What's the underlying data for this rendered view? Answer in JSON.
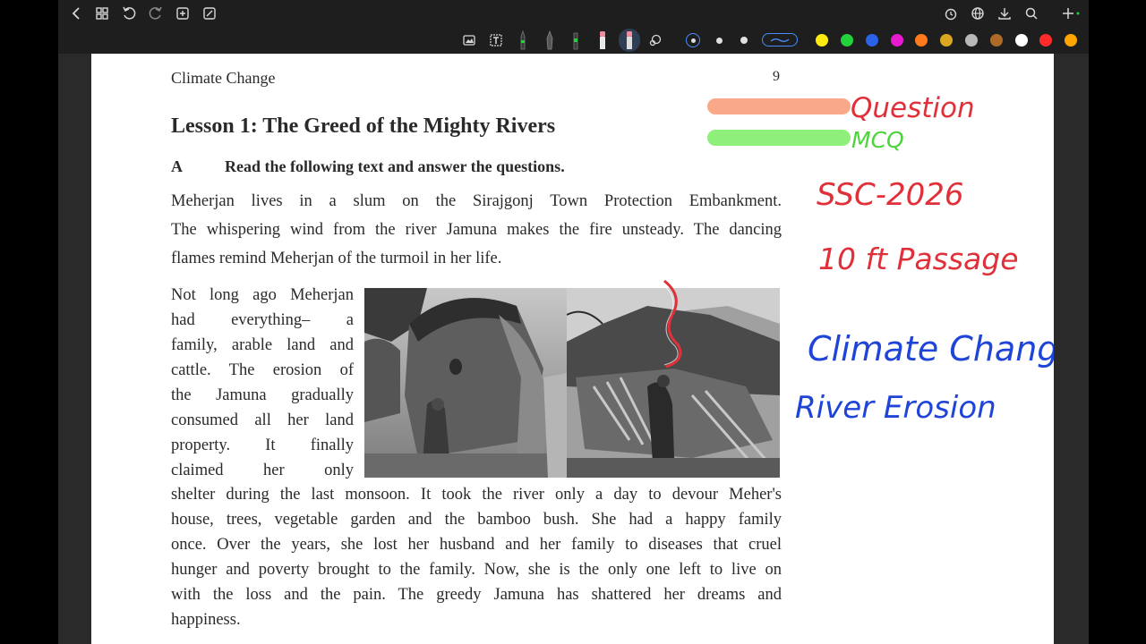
{
  "toolbar": {
    "icons": [
      "back-icon",
      "grid-icon",
      "undo-icon",
      "redo-icon",
      "add-page-icon",
      "edit-icon",
      "alarm-icon",
      "globe-icon",
      "download-icon",
      "search-icon",
      "add-icon"
    ],
    "tools": [
      "image-tool-icon",
      "text-tool-icon",
      "pen-tool-icon",
      "fountain-pen-icon",
      "highlighter-icon",
      "eraser-icon",
      "active-pencil-icon",
      "lasso-icon"
    ],
    "colors": [
      "#ffeb10",
      "#22d13c",
      "#2a62e8",
      "#e81bd0",
      "#ff7a1a",
      "#d9a820",
      "#b8b8b8",
      "#b06a28",
      "#ffffff",
      "#ff2a2a",
      "#ffa500"
    ]
  },
  "page": {
    "running_head": "Climate Change",
    "page_number": "9",
    "lesson_title": "Lesson 1: The Greed of the Mighty Rivers",
    "section_letter": "A",
    "instruction": "Read the following text and answer the questions.",
    "intro_lines": [
      "Meherjan lives in a slum on the Sirajgonj Town Protection Embankment.",
      "The whispering wind from the river Jamuna makes the fire unsteady. The dancing",
      "flames remind Meherjan of the turmoil in her life."
    ],
    "wrapped_lines": [
      "Not long ago Meherjan",
      "had everything– a",
      "family, arable land and",
      "cattle. The erosion of",
      "the Jamuna gradually",
      "consumed all her land",
      "property. It finally",
      "claimed her only"
    ],
    "body_lines": [
      "shelter during the last monsoon. It took the river only a day to devour Meher's",
      "house, trees, vegetable garden and the bamboo bush. She had a happy family",
      "once. Over the years, she lost her husband and her family to diseases that cruel",
      "hunger and poverty brought to the family. Now, she is the only one left to live on",
      "with the loss and the pain. The greedy Jamuna has shattered her dreams and",
      "happiness."
    ]
  },
  "annotations": {
    "legend": [
      {
        "label": "Question",
        "color": "#f9a98a"
      },
      {
        "label": "MCQ",
        "color": "#8ef07a"
      }
    ],
    "notes": [
      "SSC-2026",
      "10 ft Passage",
      "Climate Change",
      "River Erosion"
    ]
  }
}
